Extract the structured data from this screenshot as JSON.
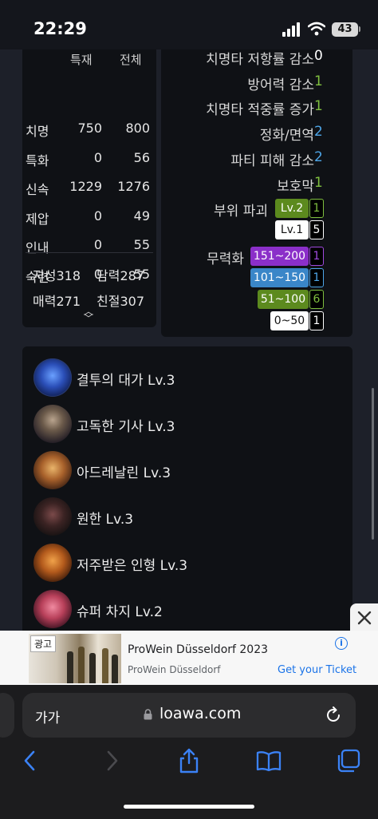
{
  "status_bar": {
    "time": "22:29",
    "battery": "43"
  },
  "stats": {
    "header_left": "특재",
    "header_right": "전체",
    "rows": [
      {
        "name": "치명",
        "value": "750",
        "total": "800"
      },
      {
        "name": "특화",
        "value": "0",
        "total": "56"
      },
      {
        "name": "신속",
        "value": "1229",
        "total": "1276"
      },
      {
        "name": "제압",
        "value": "0",
        "total": "49"
      },
      {
        "name": "인내",
        "value": "0",
        "total": "55"
      },
      {
        "name": "숙련",
        "value": "0",
        "total": "55"
      }
    ],
    "attributes": [
      {
        "name": "지성",
        "value": "318"
      },
      {
        "name": "담력",
        "value": "287"
      },
      {
        "name": "매력",
        "value": "271"
      },
      {
        "name": "친절",
        "value": "307"
      }
    ]
  },
  "effects": {
    "rows": [
      {
        "name": "치명타 저항률 감소",
        "value": "0",
        "color": "#ffffff"
      },
      {
        "name": "방어력 감소",
        "value": "1",
        "color": "#7fbf3f"
      },
      {
        "name": "치명타 적중률 증가",
        "value": "1",
        "color": "#7fbf3f"
      },
      {
        "name": "정화/면역",
        "value": "2",
        "color": "#4ea6e8"
      },
      {
        "name": "파티 피해 감소",
        "value": "2",
        "color": "#4ea6e8"
      },
      {
        "name": "보호막",
        "value": "1",
        "color": "#7fbf3f"
      }
    ],
    "part_break": {
      "label": "부위 파괴",
      "levels": [
        {
          "label": "Lv.2",
          "count": "1",
          "bg": "#5c8a1e",
          "fg": "#ffffff",
          "count_color": "#7fbf3f"
        },
        {
          "label": "Lv.1",
          "count": "5",
          "bg": "#ffffff",
          "fg": "#111111",
          "count_color": "#ffffff"
        }
      ]
    },
    "stagger": {
      "label": "무력화",
      "levels": [
        {
          "label": "151~200",
          "count": "1",
          "bg": "#8b2fc9",
          "fg": "#ffffff",
          "count_color": "#a04ae0"
        },
        {
          "label": "101~150",
          "count": "1",
          "bg": "#3a86c8",
          "fg": "#ffffff",
          "count_color": "#4ea6e8"
        },
        {
          "label": "51~100",
          "count": "6",
          "bg": "#5c8a1e",
          "fg": "#ffffff",
          "count_color": "#7fbf3f"
        },
        {
          "label": "0~50",
          "count": "1",
          "bg": "#ffffff",
          "fg": "#111111",
          "count_color": "#ffffff"
        }
      ]
    }
  },
  "engravings": [
    {
      "name": "결투의 대가 Lv.3",
      "icon": "duel-master-icon"
    },
    {
      "name": "고독한 기사 Lv.3",
      "icon": "lone-knight-icon"
    },
    {
      "name": "아드레날린 Lv.3",
      "icon": "adrenaline-icon"
    },
    {
      "name": "원한 Lv.3",
      "icon": "grudge-icon"
    },
    {
      "name": "저주받은 인형 Lv.3",
      "icon": "cursed-doll-icon"
    },
    {
      "name": "슈퍼 차지 Lv.2",
      "icon": "super-charge-icon"
    }
  ],
  "ad": {
    "tag": "광고",
    "title": "ProWein Düsseldorf 2023",
    "subtitle": "ProWein Düsseldorf",
    "cta": "Get your Ticket"
  },
  "browser": {
    "text_size_label": "가가",
    "host": "loawa.com"
  }
}
